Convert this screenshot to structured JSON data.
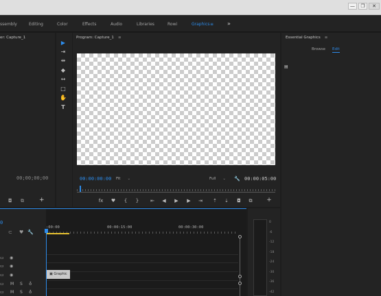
{
  "window": {
    "minimize": "—",
    "restore": "❐",
    "close": "✕"
  },
  "workspaces": {
    "items": [
      "Assembly",
      "Editing",
      "Color",
      "Effects",
      "Audio",
      "Libraries",
      "Rowi",
      "Graphics"
    ],
    "visible_labels": [
      "ssembly",
      "Editing",
      "Color",
      "Effects",
      "Audio",
      "Libraries",
      "Rowi",
      "Graphics"
    ],
    "active": "Graphics",
    "menu_icon": "≡",
    "more_icon": "»"
  },
  "source_panel": {
    "title": "er: Capture_1",
    "timecode": "00;00;00;00"
  },
  "tools": {
    "icons": [
      "selection-tool-icon",
      "track-select-tool-icon",
      "ripple-edit-tool-icon",
      "razor-tool-icon",
      "slip-tool-icon",
      "pen-tool-icon",
      "hand-tool-icon",
      "type-tool-icon"
    ]
  },
  "program_monitor": {
    "title": "Program: Capture_1",
    "menu_icon": "≡",
    "current_timecode": "00:00:00:00",
    "zoom": "Fit",
    "resolution": "Full",
    "duration": "00:00:05:00",
    "playhead_fraction": 0.0
  },
  "essential_graphics": {
    "title": "Essential Graphics",
    "menu_icon": "≡",
    "tabs": [
      "Browse",
      "Edit"
    ],
    "active_tab": "Edit"
  },
  "timeline": {
    "timecode": "0",
    "ruler_labels": [
      ":00:00",
      "00:00:15:00",
      "00:00:30:00"
    ],
    "clip_label": "Graphic",
    "track_toggle_labels": [
      "M",
      "S"
    ]
  },
  "audio_meter": {
    "db_labels": [
      "0",
      "-6",
      "-12",
      "-18",
      "-24",
      "-30",
      "-36",
      "-42"
    ]
  },
  "colors": {
    "accent": "#2d8ceb",
    "work_area": "#e8c230",
    "panel": "#232323",
    "background": "#1d1d1d"
  }
}
